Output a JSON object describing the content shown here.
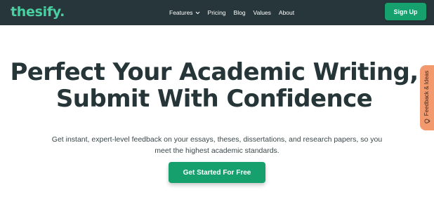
{
  "header": {
    "logo": "thesify.",
    "nav": [
      {
        "label": "Features",
        "has_dropdown": true
      },
      {
        "label": "Pricing"
      },
      {
        "label": "Blog"
      },
      {
        "label": "Values"
      },
      {
        "label": "About"
      }
    ],
    "signup_label": "Sign Up"
  },
  "hero": {
    "headline_line1": "Perfect Your Academic Writing,",
    "headline_line2": "Submit With Confidence",
    "subtext_line1": "Get instant, expert-level feedback on your essays, theses, dissertations, and research papers, so you",
    "subtext_line2": "meet the highest academic standards.",
    "cta_label": "Get Started For Free"
  },
  "feedback_tab": {
    "label": "Feedback & Ideas",
    "icon": "lightbulb-icon"
  },
  "colors": {
    "header_bg": "#27363a",
    "brand_green": "#4ad0a0",
    "button_green": "#16a06e",
    "headline_text": "#253538",
    "feedback_tab_bg": "#f29a6e"
  }
}
